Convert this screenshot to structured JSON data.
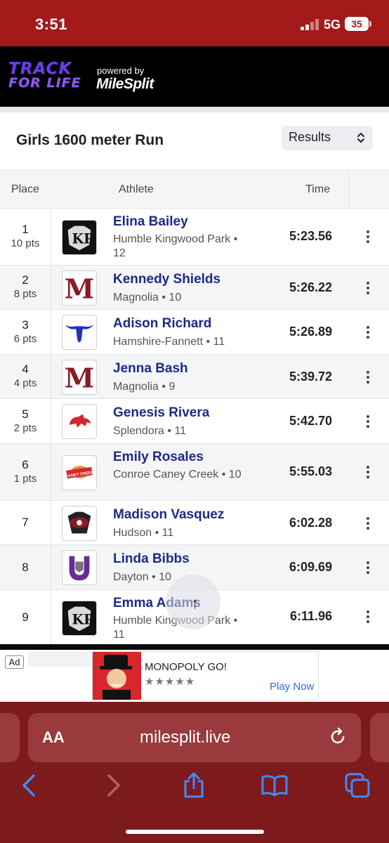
{
  "status_bar": {
    "time": "3:51",
    "network": "5G",
    "battery": "35"
  },
  "site_header": {
    "logo_line1": "TRACK",
    "logo_line2": "FOR LIFE",
    "powered_by": "powered by",
    "brand": "MileSplit"
  },
  "event": {
    "title": "Girls 1600 meter Run",
    "view_select": "Results"
  },
  "table": {
    "headers": {
      "place": "Place",
      "athlete": "Athlete",
      "time": "Time"
    },
    "rows": [
      {
        "place": "1",
        "pts": "10 pts",
        "name": "Elina Bailey",
        "school": "Humble Kingwood Park • 12",
        "time": "5:23.56",
        "logo": "kingwood-park-logo"
      },
      {
        "place": "2",
        "pts": "8 pts",
        "name": "Kennedy Shields",
        "school": "Magnolia • 10",
        "time": "5:26.22",
        "logo": "magnolia-logo"
      },
      {
        "place": "3",
        "pts": "6 pts",
        "name": "Adison Richard",
        "school": "Hamshire-Fannett • 11",
        "time": "5:26.89",
        "logo": "longhorn-logo"
      },
      {
        "place": "4",
        "pts": "4 pts",
        "name": "Jenna Bash",
        "school": "Magnolia • 9",
        "time": "5:39.72",
        "logo": "magnolia-logo"
      },
      {
        "place": "5",
        "pts": "2 pts",
        "name": "Genesis Rivera",
        "school": "Splendora • 11",
        "time": "5:42.70",
        "logo": "wildcat-logo"
      },
      {
        "place": "6",
        "pts": "1 pts",
        "name": "Emily Rosales",
        "school": "Conroe Caney Creek • 10",
        "time": "5:55.03",
        "logo": "caney-creek-logo"
      },
      {
        "place": "7",
        "pts": "",
        "name": "Madison Vasquez",
        "school": "Hudson • 11",
        "time": "6:02.28",
        "logo": "hudson-logo"
      },
      {
        "place": "8",
        "pts": "",
        "name": "Linda Bibbs",
        "school": "Dayton • 10",
        "time": "6:09.69",
        "logo": "dayton-logo"
      },
      {
        "place": "9",
        "pts": "",
        "name": "Emma Adams",
        "school": "Humble Kingwood Park • 11",
        "time": "6:11.96",
        "logo": "kingwood-park-logo"
      }
    ],
    "magnolia_letter": "M"
  },
  "ad": {
    "label": "Ad",
    "title": "MONOPOLY GO!",
    "stars": "★★★★★",
    "cta": "Play Now",
    "logo_text": "CANEY CREEK"
  },
  "safari": {
    "aa": "AA",
    "url": "milesplit.live"
  },
  "colors": {
    "status_red": "#a4191a",
    "safari_red": "#7d1a1c",
    "athlete_blue": "#1d2a86",
    "magnolia_maroon": "#8b1a24"
  }
}
